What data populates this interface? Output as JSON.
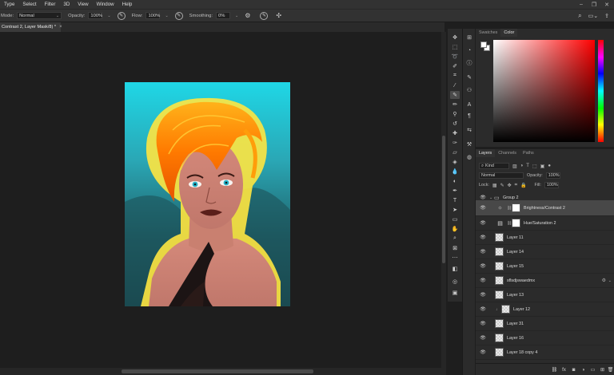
{
  "menu": {
    "items": [
      "Type",
      "Select",
      "Filter",
      "3D",
      "View",
      "Window",
      "Help"
    ]
  },
  "options": {
    "mode_label": "Mode:",
    "mode_value": "Normal",
    "opacity_label": "Opacity:",
    "opacity_value": "100%",
    "flow_label": "Flow:",
    "flow_value": "100%",
    "smoothing_label": "Smoothing:",
    "smoothing_value": "0%"
  },
  "document": {
    "tab_title": "Contrast 2, Layer Mask/8) *",
    "close": "×"
  },
  "color_panel": {
    "tabs": [
      "Swatches",
      "Color"
    ],
    "active_tab": "Color",
    "foreground": "#ffffff",
    "background": "#ffffff"
  },
  "layers_panel": {
    "tabs": [
      "Layers",
      "Channels",
      "Paths"
    ],
    "active_tab": "Layers",
    "filter_kind": "Kind",
    "blend_mode": "Normal",
    "opacity_label": "Opacity:",
    "opacity_value": "100%",
    "lock_label": "Lock:",
    "fill_label": "Fill:",
    "fill_value": "100%",
    "layers": [
      {
        "name": "Group 2",
        "kind": "group",
        "indent": 0,
        "selected": false
      },
      {
        "name": "Brightness/Contrast 2",
        "kind": "adjustment",
        "indent": 1,
        "selected": true
      },
      {
        "name": "Hue/Saturation 2",
        "kind": "adjustment",
        "indent": 1,
        "selected": false
      },
      {
        "name": "Layer 11",
        "kind": "pixel",
        "indent": 0,
        "selected": false
      },
      {
        "name": "Layer 14",
        "kind": "pixel",
        "indent": 0,
        "selected": false
      },
      {
        "name": "Layer 15",
        "kind": "pixel",
        "indent": 0,
        "selected": false
      },
      {
        "name": "sflsdjswaedmx",
        "kind": "smart",
        "indent": 0,
        "selected": false
      },
      {
        "name": "Layer 13",
        "kind": "pixel",
        "indent": 0,
        "selected": false
      },
      {
        "name": "Layer 12",
        "kind": "clipped",
        "indent": 0,
        "selected": false
      },
      {
        "name": "Layer 31",
        "kind": "pixel",
        "indent": 0,
        "selected": false
      },
      {
        "name": "Layer 16",
        "kind": "pixel",
        "indent": 0,
        "selected": false
      },
      {
        "name": "Layer 18 copy 4",
        "kind": "pixel",
        "indent": 0,
        "selected": false
      }
    ]
  },
  "colors": {
    "app_bg": "#1e1e1e",
    "panel_bg": "#2b2b2b",
    "bar_bg": "#323232",
    "selection": "#484848"
  },
  "icons": [
    "brush-icon",
    "airbrush-icon",
    "gear-icon",
    "symmetry-icon",
    "search-icon",
    "workspace-icon",
    "share-icon",
    "eye-icon",
    "chain-icon",
    "folder-icon"
  ]
}
